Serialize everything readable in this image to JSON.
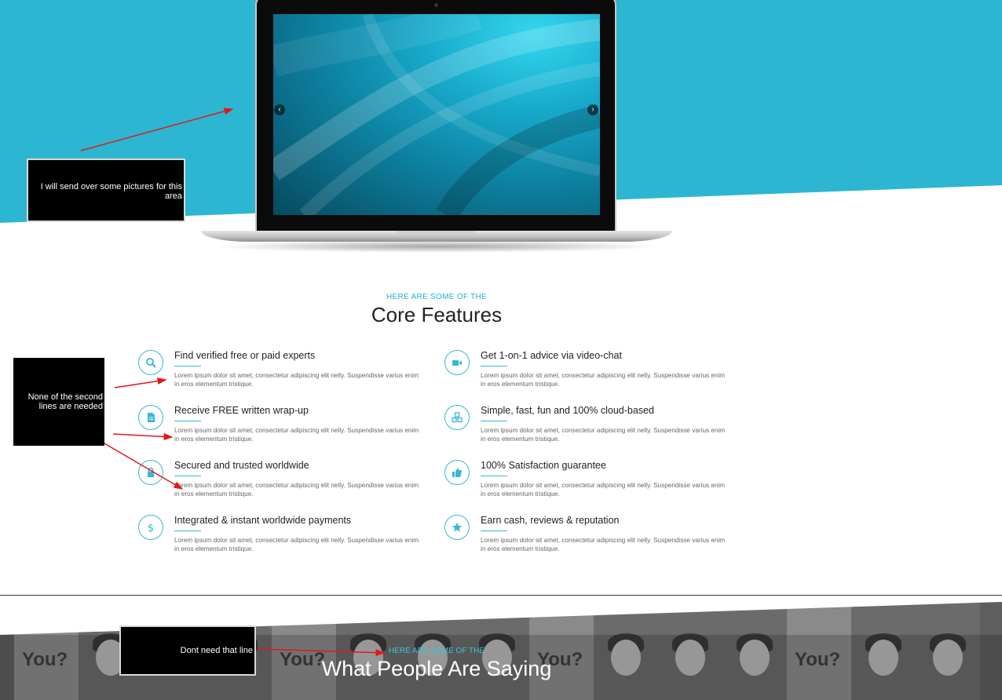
{
  "colors": {
    "accent": "#1fb3cf",
    "hero_bg": "#2db6d1",
    "arrow": "#e0191b"
  },
  "notes": {
    "pictures": "I will send over some pictures for this area",
    "second_lines": "None of the second lines are needed",
    "dont_need_line": "Dont need that line"
  },
  "carousel": {
    "prev_label": "‹",
    "next_label": "›"
  },
  "features_section": {
    "kicker": "HERE ARE SOME OF THE",
    "title": "Core Features",
    "items": [
      {
        "icon": "search-icon",
        "title": "Find verified free or paid experts",
        "desc": "Lorem ipsum dolor sit amet, consectetur adipiscing elit nelly. Suspendisse varius enim in eros elementum tristique."
      },
      {
        "icon": "video-camera-icon",
        "title": "Get 1-on-1 advice via video-chat",
        "desc": "Lorem ipsum dolor sit amet, consectetur adipiscing elit nelly. Suspendisse varius enim in eros elementum tristique."
      },
      {
        "icon": "document-icon",
        "title": "Receive FREE written wrap-up",
        "desc": "Lorem ipsum dolor sit amet, consectetur adipiscing elit nelly. Suspendisse varius enim in eros elementum tristique."
      },
      {
        "icon": "cubes-icon",
        "title": "Simple, fast, fun and 100% cloud-based",
        "desc": "Lorem ipsum dolor sit amet, consectetur adipiscing elit nelly. Suspendisse varius enim in eros elementum tristique."
      },
      {
        "icon": "lock-icon",
        "title": "Secured and trusted worldwide",
        "desc": "Lorem ipsum dolor sit amet, consectetur adipiscing elit nelly. Suspendisse varius enim in eros elementum tristique."
      },
      {
        "icon": "thumbs-up-icon",
        "title": "100% Satisfaction guarantee",
        "desc": "Lorem ipsum dolor sit amet, consectetur adipiscing elit nelly. Suspendisse varius enim in eros elementum tristique."
      },
      {
        "icon": "dollar-icon",
        "title": "Integrated & instant worldwide payments",
        "desc": "Lorem ipsum dolor sit amet, consectetur adipiscing elit nelly. Suspendisse varius enim in eros elementum tristique."
      },
      {
        "icon": "star-icon",
        "title": "Earn cash, reviews & reputation",
        "desc": "Lorem ipsum dolor sit amet, consectetur adipiscing elit nelly. Suspendisse varius enim in eros elementum tristique."
      }
    ]
  },
  "testimonials_section": {
    "kicker": "HERE ARE SOME OF THE",
    "title": "What People Are Saying",
    "tile_text": "You?"
  }
}
